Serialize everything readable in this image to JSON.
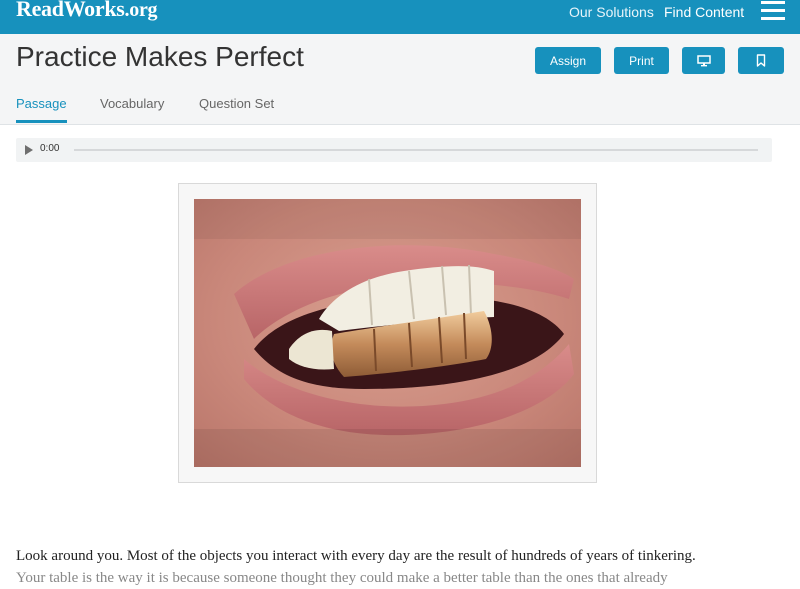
{
  "header": {
    "logo_main": "ReadWorks",
    "logo_suffix": ".org",
    "nav": [
      "Our Solutions",
      "Find Content"
    ],
    "menu_icon": "hamburger-menu-icon"
  },
  "title_bar": {
    "title": "Practice Makes Perfect",
    "buttons": {
      "assign": "Assign",
      "print": "Print",
      "present_icon": "monitor-icon",
      "bookmark_icon": "bookmark-icon"
    },
    "tabs": [
      "Passage",
      "Vocabulary",
      "Question Set"
    ],
    "active_tab": "Passage"
  },
  "audio": {
    "time": "0:00",
    "progress": 0
  },
  "passage": {
    "line1": "Look around you. Most of the objects you interact with every day are the result of hundreds of years of tinkering.",
    "line2": "Your table is the way it is because someone thought they could make a better table than the ones that already"
  },
  "colors": {
    "brand": "#1791bd"
  }
}
